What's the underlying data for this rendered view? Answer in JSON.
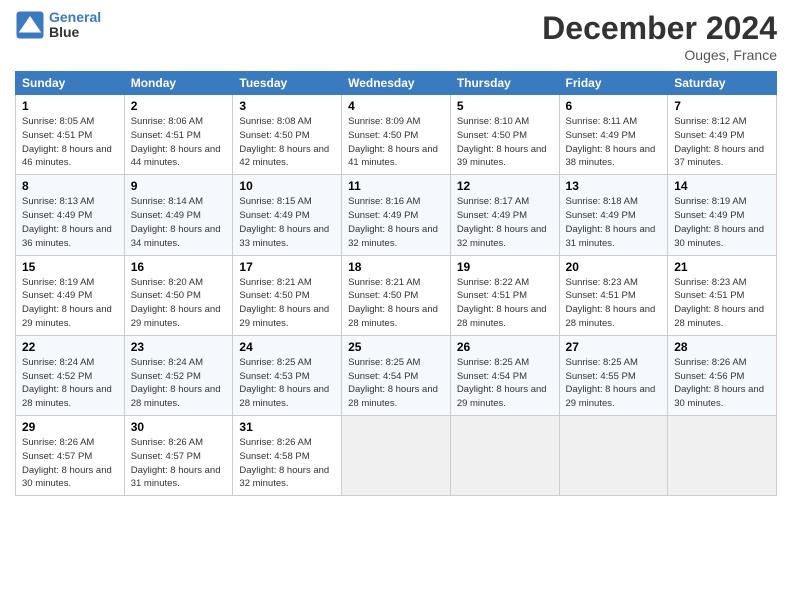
{
  "header": {
    "logo_line1": "General",
    "logo_line2": "Blue",
    "title": "December 2024",
    "subtitle": "Ouges, France"
  },
  "weekdays": [
    "Sunday",
    "Monday",
    "Tuesday",
    "Wednesday",
    "Thursday",
    "Friday",
    "Saturday"
  ],
  "weeks": [
    [
      {
        "day": "1",
        "sunrise": "8:05 AM",
        "sunset": "4:51 PM",
        "daylight": "8 hours and 46 minutes."
      },
      {
        "day": "2",
        "sunrise": "8:06 AM",
        "sunset": "4:51 PM",
        "daylight": "8 hours and 44 minutes."
      },
      {
        "day": "3",
        "sunrise": "8:08 AM",
        "sunset": "4:50 PM",
        "daylight": "8 hours and 42 minutes."
      },
      {
        "day": "4",
        "sunrise": "8:09 AM",
        "sunset": "4:50 PM",
        "daylight": "8 hours and 41 minutes."
      },
      {
        "day": "5",
        "sunrise": "8:10 AM",
        "sunset": "4:50 PM",
        "daylight": "8 hours and 39 minutes."
      },
      {
        "day": "6",
        "sunrise": "8:11 AM",
        "sunset": "4:49 PM",
        "daylight": "8 hours and 38 minutes."
      },
      {
        "day": "7",
        "sunrise": "8:12 AM",
        "sunset": "4:49 PM",
        "daylight": "8 hours and 37 minutes."
      }
    ],
    [
      {
        "day": "8",
        "sunrise": "8:13 AM",
        "sunset": "4:49 PM",
        "daylight": "8 hours and 36 minutes."
      },
      {
        "day": "9",
        "sunrise": "8:14 AM",
        "sunset": "4:49 PM",
        "daylight": "8 hours and 34 minutes."
      },
      {
        "day": "10",
        "sunrise": "8:15 AM",
        "sunset": "4:49 PM",
        "daylight": "8 hours and 33 minutes."
      },
      {
        "day": "11",
        "sunrise": "8:16 AM",
        "sunset": "4:49 PM",
        "daylight": "8 hours and 32 minutes."
      },
      {
        "day": "12",
        "sunrise": "8:17 AM",
        "sunset": "4:49 PM",
        "daylight": "8 hours and 32 minutes."
      },
      {
        "day": "13",
        "sunrise": "8:18 AM",
        "sunset": "4:49 PM",
        "daylight": "8 hours and 31 minutes."
      },
      {
        "day": "14",
        "sunrise": "8:19 AM",
        "sunset": "4:49 PM",
        "daylight": "8 hours and 30 minutes."
      }
    ],
    [
      {
        "day": "15",
        "sunrise": "8:19 AM",
        "sunset": "4:49 PM",
        "daylight": "8 hours and 29 minutes."
      },
      {
        "day": "16",
        "sunrise": "8:20 AM",
        "sunset": "4:50 PM",
        "daylight": "8 hours and 29 minutes."
      },
      {
        "day": "17",
        "sunrise": "8:21 AM",
        "sunset": "4:50 PM",
        "daylight": "8 hours and 29 minutes."
      },
      {
        "day": "18",
        "sunrise": "8:21 AM",
        "sunset": "4:50 PM",
        "daylight": "8 hours and 28 minutes."
      },
      {
        "day": "19",
        "sunrise": "8:22 AM",
        "sunset": "4:51 PM",
        "daylight": "8 hours and 28 minutes."
      },
      {
        "day": "20",
        "sunrise": "8:23 AM",
        "sunset": "4:51 PM",
        "daylight": "8 hours and 28 minutes."
      },
      {
        "day": "21",
        "sunrise": "8:23 AM",
        "sunset": "4:51 PM",
        "daylight": "8 hours and 28 minutes."
      }
    ],
    [
      {
        "day": "22",
        "sunrise": "8:24 AM",
        "sunset": "4:52 PM",
        "daylight": "8 hours and 28 minutes."
      },
      {
        "day": "23",
        "sunrise": "8:24 AM",
        "sunset": "4:52 PM",
        "daylight": "8 hours and 28 minutes."
      },
      {
        "day": "24",
        "sunrise": "8:25 AM",
        "sunset": "4:53 PM",
        "daylight": "8 hours and 28 minutes."
      },
      {
        "day": "25",
        "sunrise": "8:25 AM",
        "sunset": "4:54 PM",
        "daylight": "8 hours and 28 minutes."
      },
      {
        "day": "26",
        "sunrise": "8:25 AM",
        "sunset": "4:54 PM",
        "daylight": "8 hours and 29 minutes."
      },
      {
        "day": "27",
        "sunrise": "8:25 AM",
        "sunset": "4:55 PM",
        "daylight": "8 hours and 29 minutes."
      },
      {
        "day": "28",
        "sunrise": "8:26 AM",
        "sunset": "4:56 PM",
        "daylight": "8 hours and 30 minutes."
      }
    ],
    [
      {
        "day": "29",
        "sunrise": "8:26 AM",
        "sunset": "4:57 PM",
        "daylight": "8 hours and 30 minutes."
      },
      {
        "day": "30",
        "sunrise": "8:26 AM",
        "sunset": "4:57 PM",
        "daylight": "8 hours and 31 minutes."
      },
      {
        "day": "31",
        "sunrise": "8:26 AM",
        "sunset": "4:58 PM",
        "daylight": "8 hours and 32 minutes."
      },
      null,
      null,
      null,
      null
    ]
  ],
  "labels": {
    "sunrise": "Sunrise: ",
    "sunset": "Sunset: ",
    "daylight": "Daylight: "
  }
}
